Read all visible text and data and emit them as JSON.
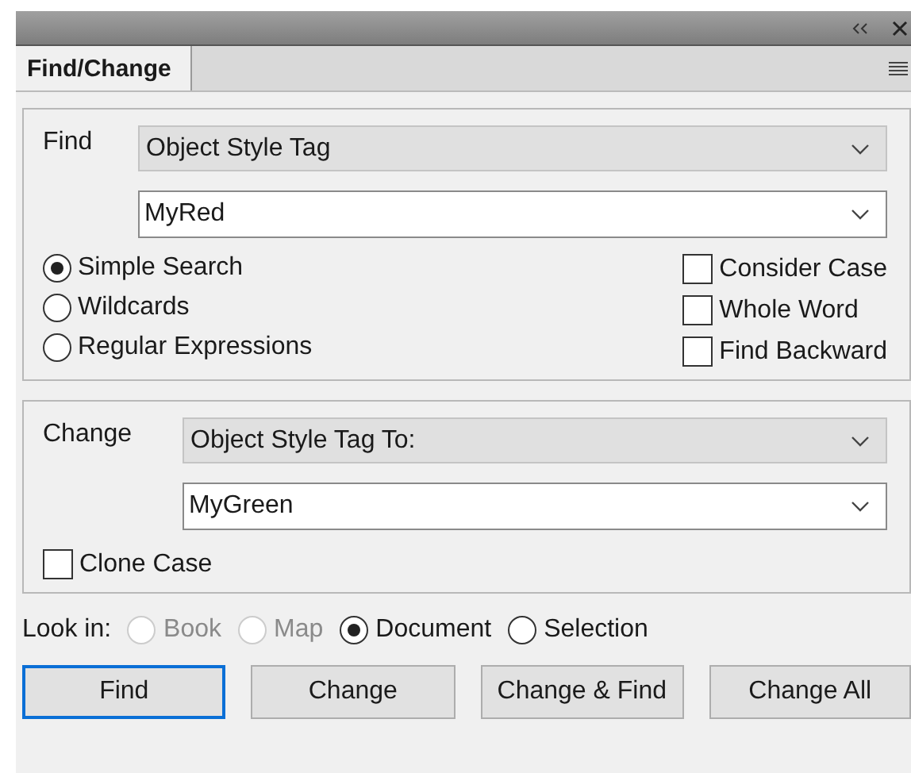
{
  "panel": {
    "title": "Find/Change"
  },
  "find": {
    "label": "Find",
    "type_value": "Object Style Tag",
    "value": "MyRed",
    "modes": [
      {
        "label": "Simple Search",
        "selected": true
      },
      {
        "label": "Wildcards",
        "selected": false
      },
      {
        "label": "Regular Expressions",
        "selected": false
      }
    ],
    "options": [
      {
        "label": "Consider Case",
        "checked": false
      },
      {
        "label": "Whole Word",
        "checked": false
      },
      {
        "label": "Find Backward",
        "checked": false
      }
    ]
  },
  "change": {
    "label": "Change",
    "type_value": "Object Style Tag To:",
    "value": "MyGreen",
    "options": [
      {
        "label": "Clone Case",
        "checked": false
      }
    ]
  },
  "look_in": {
    "label": "Look in:",
    "scopes": [
      {
        "label": "Book",
        "selected": false,
        "disabled": true
      },
      {
        "label": "Map",
        "selected": false,
        "disabled": true
      },
      {
        "label": "Document",
        "selected": true,
        "disabled": false
      },
      {
        "label": "Selection",
        "selected": false,
        "disabled": false
      }
    ]
  },
  "buttons": [
    {
      "label": "Find",
      "focused": true
    },
    {
      "label": "Change",
      "focused": false
    },
    {
      "label": "Change & Find",
      "focused": false
    },
    {
      "label": "Change All",
      "focused": false
    }
  ]
}
